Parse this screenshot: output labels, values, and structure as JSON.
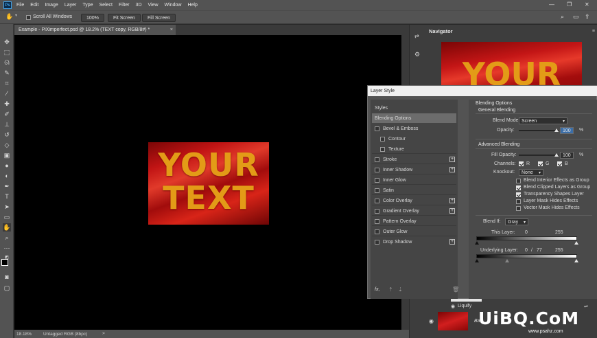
{
  "menubar": {
    "logo": "Ps",
    "items": [
      "File",
      "Edit",
      "Image",
      "Layer",
      "Type",
      "Select",
      "Filter",
      "3D",
      "View",
      "Window",
      "Help"
    ],
    "window_controls": [
      "—",
      "❐",
      "✕"
    ]
  },
  "optionsbar": {
    "scroll_all_windows_label": "Scroll All Windows",
    "zoom_button": "100%",
    "fit_screen_button": "Fit Screen",
    "fill_screen_button": "Fill Screen"
  },
  "document": {
    "tab_title": "Example - PiXimperfect.psd @ 18.2% (TEXT copy, RGB/8#) *",
    "tab_close": "×",
    "artwork_text": [
      "YOUR",
      "TEXT"
    ]
  },
  "statusbar": {
    "zoom": "18.18%",
    "profile": "Untagged RGB (8bpc)",
    "arrow": ">"
  },
  "navigator": {
    "title": "Navigator",
    "thumb_text": "YOUR"
  },
  "layers": {
    "liquify_label": "Liquify",
    "background_layer_label": "Bac"
  },
  "dialog": {
    "title": "Layer Style",
    "styles": [
      {
        "label": "Styles",
        "check": false,
        "plus": false,
        "header": true
      },
      {
        "label": "Blending Options",
        "check": false,
        "plus": false,
        "selected": true
      },
      {
        "label": "Bevel & Emboss",
        "check": true,
        "plus": false
      },
      {
        "label": "Contour",
        "check": true,
        "plus": false,
        "indent": true
      },
      {
        "label": "Texture",
        "check": true,
        "plus": false,
        "indent": true
      },
      {
        "label": "Stroke",
        "check": true,
        "plus": true
      },
      {
        "label": "Inner Shadow",
        "check": true,
        "plus": true
      },
      {
        "label": "Inner Glow",
        "check": true,
        "plus": false
      },
      {
        "label": "Satin",
        "check": true,
        "plus": false
      },
      {
        "label": "Color Overlay",
        "check": true,
        "plus": true
      },
      {
        "label": "Gradient Overlay",
        "check": true,
        "plus": true
      },
      {
        "label": "Pattern Overlay",
        "check": true,
        "plus": false
      },
      {
        "label": "Outer Glow",
        "check": true,
        "plus": false
      },
      {
        "label": "Drop Shadow",
        "check": true,
        "plus": true
      }
    ],
    "footer_fx": "fx,",
    "blending": {
      "section_title": "Blending Options",
      "general_title": "General Blending",
      "blend_mode_label": "Blend Mode:",
      "blend_mode_value": "Screen",
      "opacity_label": "Opacity:",
      "opacity_value": "100",
      "opacity_unit": "%",
      "advanced_title": "Advanced Blending",
      "fill_opacity_label": "Fill Opacity:",
      "fill_opacity_value": "100",
      "fill_opacity_unit": "%",
      "channels_label": "Channels:",
      "channel_r": "R",
      "channel_g": "G",
      "channel_b": "B",
      "knockout_label": "Knockout:",
      "knockout_value": "None",
      "options": [
        {
          "label": "Blend Interior Effects as Group",
          "checked": false
        },
        {
          "label": "Blend Clipped Layers as Group",
          "checked": true
        },
        {
          "label": "Transparency Shapes Layer",
          "checked": true
        },
        {
          "label": "Layer Mask Hides Effects",
          "checked": false
        },
        {
          "label": "Vector Mask Hides Effects",
          "checked": false
        }
      ],
      "blend_if_label": "Blend If:",
      "blend_if_value": "Gray",
      "this_layer_label": "This Layer:",
      "this_layer_low": "0",
      "this_layer_high": "255",
      "underlying_label": "Underlying Layer:",
      "underlying_low": "0",
      "underlying_sep": "/",
      "underlying_mid": "77",
      "underlying_high": "255"
    }
  },
  "watermark": {
    "text": "UiBQ.CoM",
    "sub": "www.psahz.com"
  }
}
